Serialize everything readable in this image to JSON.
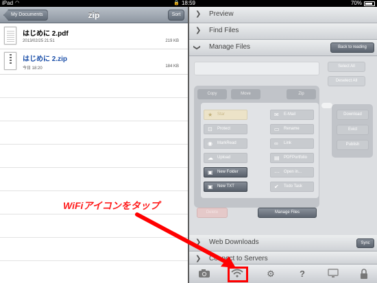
{
  "status_bar": {
    "carrier": "iPad",
    "time": "18:59",
    "battery": "70%"
  },
  "left_pane": {
    "nav": {
      "back_label": "My Documents",
      "title": "zip",
      "sort_label": "Sort"
    },
    "files": [
      {
        "name": "はじめに 2.pdf",
        "date": "2013/02/25 21:51",
        "size": "219 KB",
        "icon": "pdf-file-icon",
        "highlighted": false
      },
      {
        "name": "はじめに 2.zip",
        "date": "今日 18:20",
        "size": "184 KB",
        "icon": "zip-file-icon",
        "highlighted": true
      }
    ]
  },
  "right_pane": {
    "preview_label": "Preview",
    "find_files_label": "Find Files",
    "manage_files_label": "Manage Files",
    "back_to_reading_label": "Back to reading",
    "select_all_label": "Select All",
    "deselect_all_label": "Deselect All",
    "tabs": {
      "copy": "Copy",
      "move": "Move",
      "zip": "Zip"
    },
    "actions": {
      "star": "Star",
      "email": "E-Mail",
      "protect": "Protect",
      "rename": "Rename",
      "markread": "MarkRead",
      "link": "Link",
      "upload": "Upload",
      "pdfportfolio": "PDFPortfolio",
      "new_folder": "New Folder",
      "open_in": "Open in...",
      "new_txt": "New TXT",
      "todo_task": "Todo Task"
    },
    "cloud_actions": {
      "download": "Download",
      "evict": "Evict",
      "publish": "Publish"
    },
    "delete_label": "Delete",
    "manage_files_button": "Manage Files",
    "web_downloads_label": "Web Downloads",
    "sync_label": "Sync",
    "connect_servers_label": "Connect to Servers"
  },
  "toolbar": {
    "question_glyph": "?",
    "icons": [
      "camera-icon",
      "wifi-icon",
      "gear-icon",
      "help-icon",
      "display-icon",
      "lock-icon"
    ]
  },
  "annotation": {
    "text": "WiFiアイコンをタップ",
    "color": "#ff0000"
  }
}
